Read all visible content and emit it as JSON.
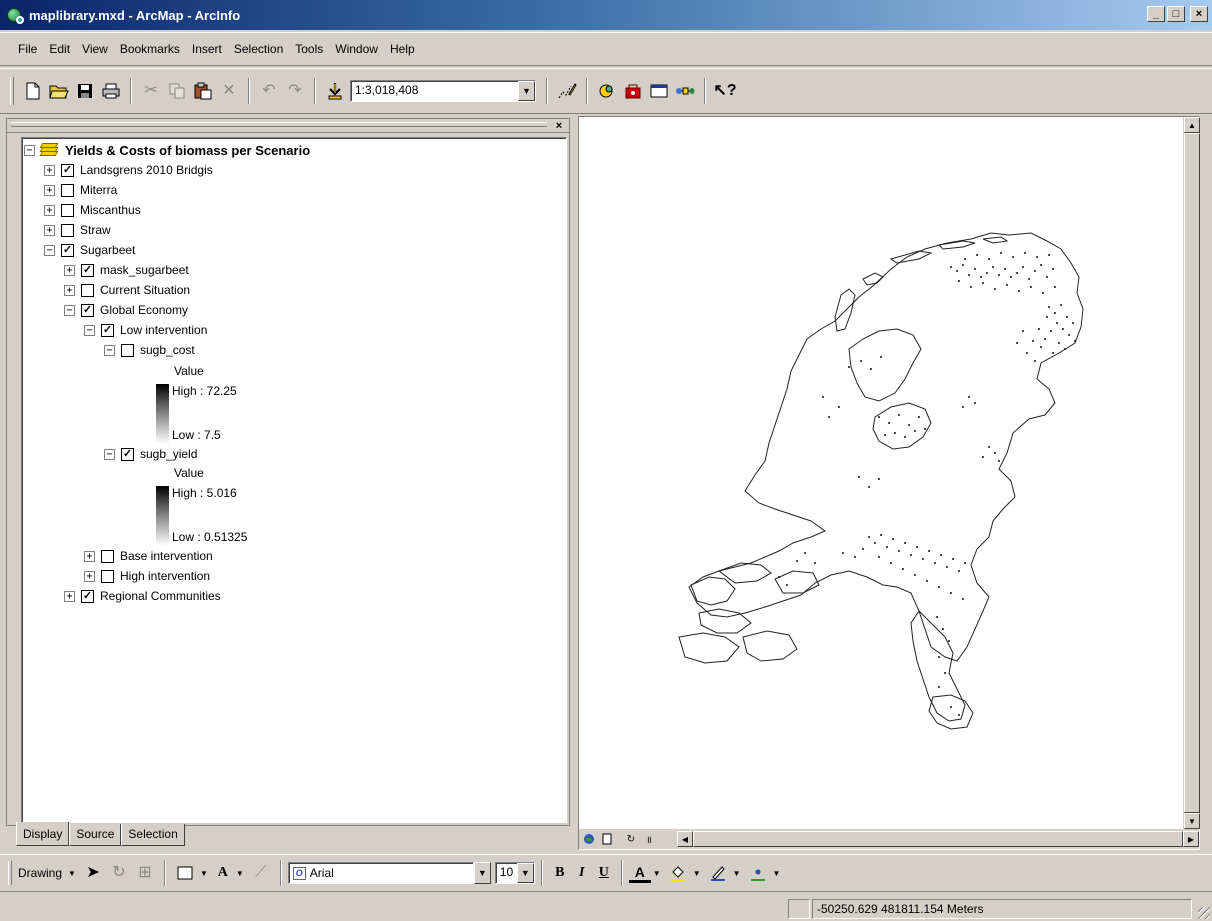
{
  "window": {
    "title": "maplibrary.mxd - ArcMap - ArcInfo",
    "buttons": {
      "minimize": "_",
      "maximize": "□",
      "close": "×"
    }
  },
  "menu": {
    "items": [
      {
        "label": "File"
      },
      {
        "label": "Edit"
      },
      {
        "label": "View"
      },
      {
        "label": "Bookmarks"
      },
      {
        "label": "Insert"
      },
      {
        "label": "Selection"
      },
      {
        "label": "Tools"
      },
      {
        "label": "Window"
      },
      {
        "label": "Help"
      }
    ]
  },
  "standard_toolbar": {
    "scale": "1:3,018,408",
    "icons": [
      "new-document-icon",
      "open-icon",
      "save-icon",
      "print-icon",
      "cut-icon",
      "copy-icon",
      "paste-icon",
      "delete-icon",
      "undo-icon",
      "redo-icon",
      "add-data-icon",
      "scale-dropdown",
      "editor-toolbar-icon",
      "arccatalog-icon",
      "arctoolbox-icon",
      "command-line-icon",
      "modelbuilder-icon",
      "whats-this-icon"
    ]
  },
  "toc": {
    "close": "×",
    "root": "Yields & Costs of biomass per Scenario",
    "layers": [
      {
        "label": "Landsgrens 2010 Bridgis",
        "checked": true,
        "expander": "+"
      },
      {
        "label": "Miterra",
        "checked": false,
        "expander": "+"
      },
      {
        "label": "Miscanthus",
        "checked": false,
        "expander": "+"
      },
      {
        "label": "Straw",
        "checked": false,
        "expander": "+"
      },
      {
        "label": "Sugarbeet",
        "checked": true,
        "expander": "−"
      },
      {
        "label": "mask_sugarbeet",
        "checked": true,
        "expander": "+"
      },
      {
        "label": "Current Situation",
        "checked": false,
        "expander": "+"
      },
      {
        "label": "Global Economy",
        "checked": true,
        "expander": "−"
      },
      {
        "label": "Low intervention",
        "checked": true,
        "expander": "−"
      },
      {
        "label": "sugb_cost",
        "checked": false,
        "expander": "−"
      },
      {
        "label": "sugb_yield",
        "checked": true,
        "expander": "−"
      },
      {
        "label": "Base intervention",
        "checked": false,
        "expander": "+"
      },
      {
        "label": "High intervention",
        "checked": false,
        "expander": "+"
      },
      {
        "label": "Regional Communities",
        "checked": true,
        "expander": "+"
      }
    ],
    "legends": [
      {
        "heading": "Value",
        "high": "High : 72.25",
        "low": "Low : 7.5"
      },
      {
        "heading": "Value",
        "high": "High : 5.016",
        "low": "Low : 0.51325"
      }
    ],
    "tabs": [
      "Display",
      "Source",
      "Selection"
    ]
  },
  "drawing_toolbar": {
    "label": "Drawing",
    "font": "Arial",
    "font_size": "10",
    "bold": "B",
    "italic": "I",
    "underline": "U",
    "font_color_glyph": "A",
    "text_tool_glyph": "A"
  },
  "status": {
    "coordinates": "-50250.629  481811.154 Meters"
  },
  "colors": {
    "title_start": "#0a246a",
    "title_end": "#a6caf0",
    "chrome": "#d4d0c8",
    "map_bg": "#ffffff"
  }
}
